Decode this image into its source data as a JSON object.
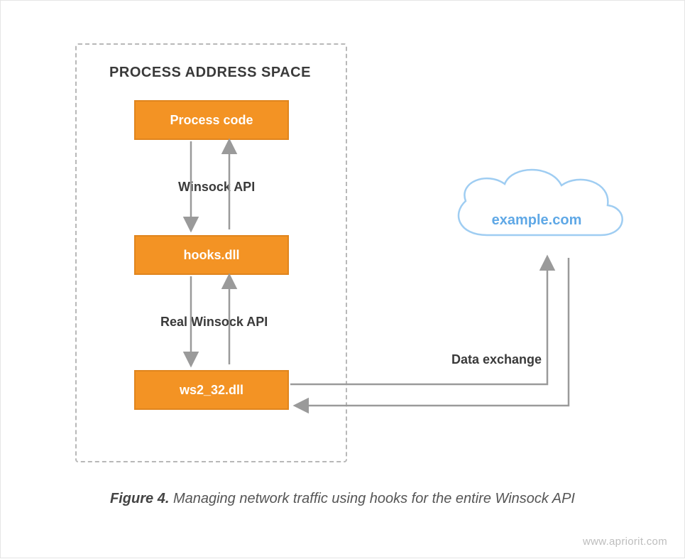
{
  "section_title": "PROCESS ADDRESS SPACE",
  "nodes": {
    "process_code": "Process code",
    "hooks_dll": "hooks.dll",
    "ws2_dll": "ws2_32.dll"
  },
  "edge_labels": {
    "winsock": "Winsock API",
    "real_winsock": "Real Winsock API",
    "data_exchange": "Data exchange"
  },
  "cloud": {
    "host": "example.com"
  },
  "caption": {
    "prefix": "Figure 4.",
    "text": " Managing network traffic using hooks for the entire Winsock API"
  },
  "watermark": "www.apriorit.com",
  "colors": {
    "node_bg": "#f39324",
    "node_border": "#e0851e",
    "arrow": "#9a9a9a",
    "dash": "#b8b8b8",
    "cloud": "#9fcdf2"
  }
}
